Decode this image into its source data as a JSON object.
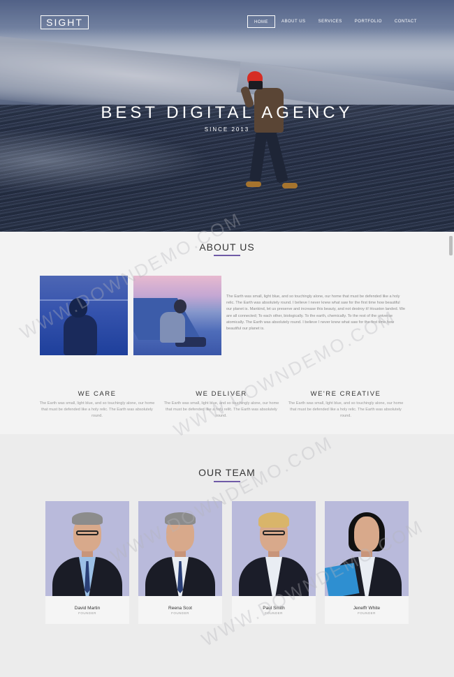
{
  "header": {
    "logo": "SIGHT",
    "nav": [
      "HOME",
      "ABOUT US",
      "SERVICES",
      "PORTFOLIO",
      "CONTACT"
    ],
    "active_nav": "HOME"
  },
  "hero": {
    "title": "BEST DIGITAL AGENCY",
    "subtitle": "SINCE 2013"
  },
  "about": {
    "title": "ABOUT US",
    "text": "The Earth was small, light blue, and so touchingly alone, our home that must be defended like a holy relic. The Earth was absolutely round. I believe I never knew what saw for the first time how beautiful our planet is. Mankind, let us preserve and increase this beauty, and not destroy it! Houston landed. We are all connected; To each other, biologically. To the earth, chemically. To the rest of the universe atomically. The Earth was absolutely round. I believe I never knew what saw for the first time how beautiful our planet is."
  },
  "features": [
    {
      "title": "WE CARE",
      "text": "The Earth was small, light blue, and so touchingly alone, our home that must be defended like a holy relic. The Earth was absolutely round."
    },
    {
      "title": "WE DELIVER",
      "text": "The Earth was small, light blue, and so touchingly alone, our home that must be defended like a holy relic. The Earth was absolutely round."
    },
    {
      "title": "WE'RE CREATIVE",
      "text": "The Earth was small, light blue, and so touchingly alone, our home that must be defended like a holy relic. The Earth was absolutely round."
    }
  ],
  "team": {
    "title": "OUR TEAM",
    "members": [
      {
        "name": "David Martin",
        "role": "FOUNDER"
      },
      {
        "name": "Reena Scot",
        "role": "FOUNDER"
      },
      {
        "name": "Paul Smith",
        "role": "FOUNDER"
      },
      {
        "name": "Jeneffr White",
        "role": "FOUNDER"
      }
    ]
  },
  "watermark": "WWW.DOWNDEMO.COM",
  "colors": {
    "accent": "#6f5aa7",
    "hero_overlay": "#3a4458"
  }
}
